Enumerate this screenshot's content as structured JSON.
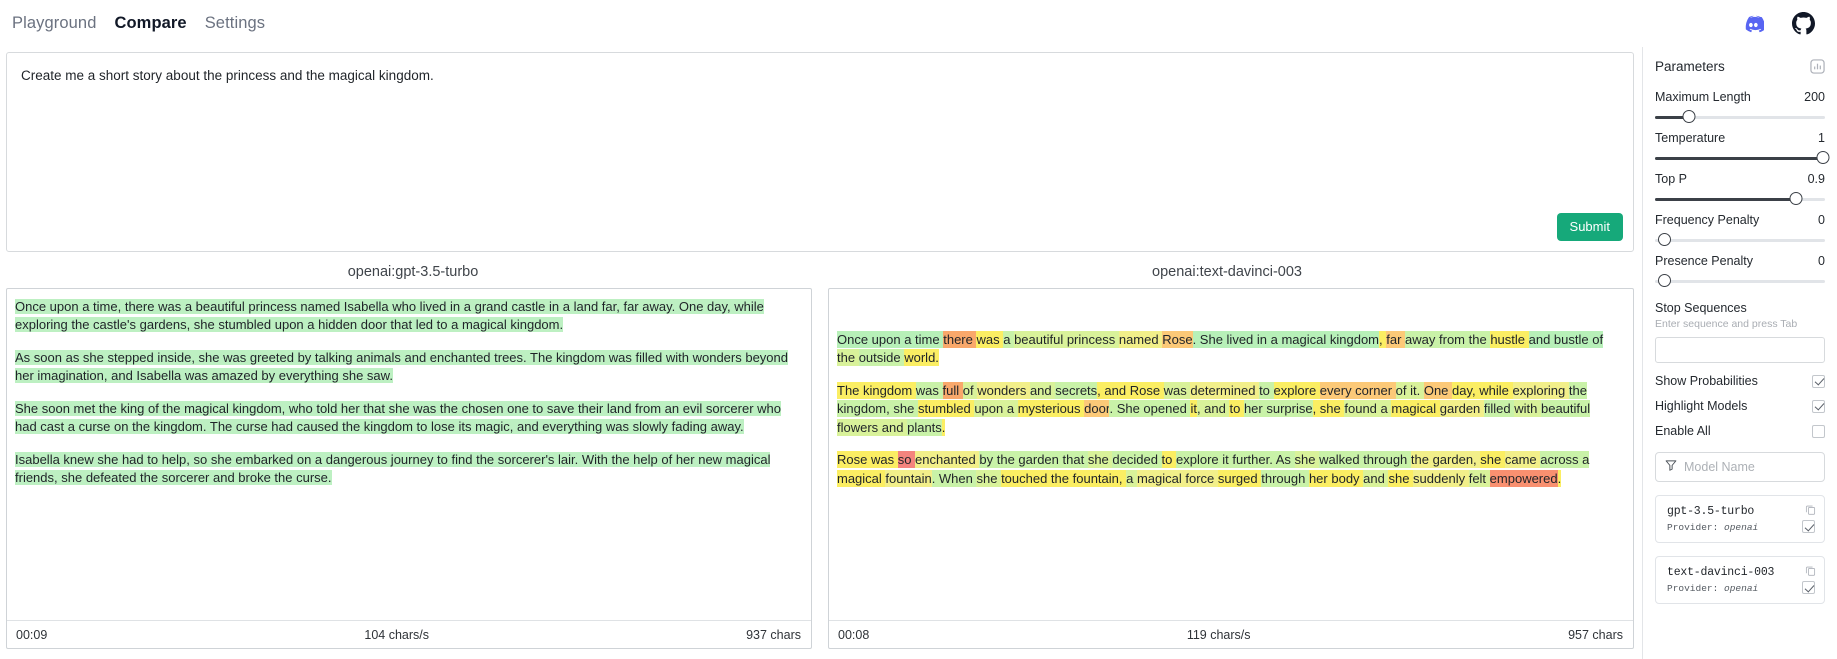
{
  "nav": {
    "items": [
      {
        "label": "Playground",
        "active": false
      },
      {
        "label": "Compare",
        "active": true
      },
      {
        "label": "Settings",
        "active": false
      }
    ],
    "discord_icon": "discord-icon",
    "github_icon": "github-icon"
  },
  "prompt": {
    "text": "Create me a short story about the princess and the magical kingdom.",
    "submit_label": "Submit"
  },
  "outputs": [
    {
      "title": "openai:gpt-3.5-turbo",
      "paragraphs": [
        "Once upon a time, there was a beautiful princess named Isabella who lived in a grand castle in a land far, far away. One day, while exploring the castle's gardens, she stumbled upon a hidden door that led to a magical kingdom.",
        "As soon as she stepped inside, she was greeted by talking animals and enchanted trees. The kingdom was filled with wonders beyond her imagination, and Isabella was amazed by everything she saw.",
        "She soon met the king of the magical kingdom, who told her that she was the chosen one to save their land from an evil sorcerer who had cast a curse on the kingdom. The curse had caused the kingdom to lose its magic, and everything was slowly fading away.",
        "Isabella knew she had to help, so she embarked on a dangerous journey to find the sorcerer's lair. With the help of her new magical friends, she defeated the sorcerer and broke the curse."
      ],
      "footer": {
        "time": "00:09",
        "speed": "104 chars/s",
        "chars": "937 chars"
      }
    },
    {
      "title": "openai:text-davinci-003",
      "token_paragraphs": [
        [
          {
            "t": "Once upon a time ",
            "c": "g0"
          },
          {
            "t": "there ",
            "c": "o1"
          },
          {
            "t": "was ",
            "c": "y1"
          },
          {
            "t": "a ",
            "c": "g1"
          },
          {
            "t": "beautiful princess ",
            "c": "g2"
          },
          {
            "t": "named ",
            "c": "y0"
          },
          {
            "t": "Rose",
            "c": "o0"
          },
          {
            "t": ". She lived in a magical kingdom",
            "c": "g0"
          },
          {
            "t": ", ",
            "c": "y1"
          },
          {
            "t": "far ",
            "c": "o0"
          },
          {
            "t": "away from the ",
            "c": "g1"
          },
          {
            "t": "hustle ",
            "c": "y1"
          },
          {
            "t": "and bustle of ",
            "c": "g0"
          },
          {
            "t": "the ",
            "c": "g2"
          },
          {
            "t": "outside ",
            "c": "g1"
          },
          {
            "t": "world.",
            "c": "y1"
          }
        ],
        [
          {
            "t": "The kingdom ",
            "c": "y1"
          },
          {
            "t": "was ",
            "c": "g1"
          },
          {
            "t": "full ",
            "c": "o1"
          },
          {
            "t": "of ",
            "c": "g2"
          },
          {
            "t": "wonders ",
            "c": "y0"
          },
          {
            "t": "and ",
            "c": "g2"
          },
          {
            "t": "secrets",
            "c": "g1"
          },
          {
            "t": ", and Rose ",
            "c": "y1"
          },
          {
            "t": "was ",
            "c": "g2"
          },
          {
            "t": "determined ",
            "c": "y0"
          },
          {
            "t": "to ",
            "c": "g1"
          },
          {
            "t": "explore ",
            "c": "y1"
          },
          {
            "t": "every corner ",
            "c": "o0"
          },
          {
            "t": "of it. ",
            "c": "g2"
          },
          {
            "t": "One ",
            "c": "o0"
          },
          {
            "t": "day, while ",
            "c": "y1"
          },
          {
            "t": "exploring ",
            "c": "y0"
          },
          {
            "t": "the kingdom, she ",
            "c": "g1"
          },
          {
            "t": "stumbled ",
            "c": "y1"
          },
          {
            "t": "upon a ",
            "c": "g2"
          },
          {
            "t": "mysterious ",
            "c": "y1"
          },
          {
            "t": "door",
            "c": "o0"
          },
          {
            "t": ". She opened ",
            "c": "g1"
          },
          {
            "t": "it",
            "c": "y1"
          },
          {
            "t": ", and ",
            "c": "g2"
          },
          {
            "t": "to ",
            "c": "y1"
          },
          {
            "t": "her surprise",
            "c": "g1"
          },
          {
            "t": ", she ",
            "c": "y1"
          },
          {
            "t": "found a ",
            "c": "g2"
          },
          {
            "t": "magical ",
            "c": "y1"
          },
          {
            "t": "garden ",
            "c": "y0"
          },
          {
            "t": "filled ",
            "c": "g1"
          },
          {
            "t": "with ",
            "c": "g2"
          },
          {
            "t": "beautiful ",
            "c": "g1"
          },
          {
            "t": "flowers and ",
            "c": "g2"
          },
          {
            "t": "plants",
            "c": "g1"
          },
          {
            "t": ".",
            "c": "y1"
          }
        ],
        [
          {
            "t": "Rose was ",
            "c": "y1"
          },
          {
            "t": "so ",
            "c": "r1"
          },
          {
            "t": "enchanted ",
            "c": "y0"
          },
          {
            "t": "by the garden that ",
            "c": "g1"
          },
          {
            "t": "she ",
            "c": "g2"
          },
          {
            "t": "decided ",
            "c": "g1"
          },
          {
            "t": "to ",
            "c": "y1"
          },
          {
            "t": "explore it further. As ",
            "c": "g1"
          },
          {
            "t": "she ",
            "c": "g2"
          },
          {
            "t": "walked through ",
            "c": "g1"
          },
          {
            "t": "the garden, ",
            "c": "y0"
          },
          {
            "t": "she ",
            "c": "y1"
          },
          {
            "t": "came ",
            "c": "y0"
          },
          {
            "t": "across a ",
            "c": "g1"
          },
          {
            "t": "magical ",
            "c": "y1"
          },
          {
            "t": "fountain",
            "c": "y0"
          },
          {
            "t": ". When ",
            "c": "g1"
          },
          {
            "t": "she ",
            "c": "g2"
          },
          {
            "t": "touched the fountain, ",
            "c": "y1"
          },
          {
            "t": "a ",
            "c": "g2"
          },
          {
            "t": "magical force ",
            "c": "y0"
          },
          {
            "t": "surged ",
            "c": "y1"
          },
          {
            "t": "through ",
            "c": "g1"
          },
          {
            "t": "her body ",
            "c": "y1"
          },
          {
            "t": "and ",
            "c": "g2"
          },
          {
            "t": "she ",
            "c": "y1"
          },
          {
            "t": "suddenly ",
            "c": "y0"
          },
          {
            "t": "felt ",
            "c": "g2"
          },
          {
            "t": "empowered",
            "c": "r0"
          },
          {
            "t": ".",
            "c": "y1"
          }
        ]
      ],
      "footer": {
        "time": "00:08",
        "speed": "119 chars/s",
        "chars": "957 chars"
      }
    }
  ],
  "parameters": {
    "title": "Parameters",
    "chart_icon": "bar-chart-icon",
    "sliders": [
      {
        "label": "Maximum Length",
        "value": "200",
        "pct": 20
      },
      {
        "label": "Temperature",
        "value": "1",
        "pct": 100
      },
      {
        "label": "Top P",
        "value": "0.9",
        "pct": 83
      },
      {
        "label": "Frequency Penalty",
        "value": "0",
        "pct": 0
      },
      {
        "label": "Presence Penalty",
        "value": "0",
        "pct": 0
      }
    ],
    "stop_sequences": {
      "label": "Stop Sequences",
      "hint": "Enter sequence and press Tab",
      "value": ""
    },
    "toggles": [
      {
        "label": "Show Probabilities",
        "checked": true
      },
      {
        "label": "Highlight Models",
        "checked": true
      },
      {
        "label": "Enable All",
        "checked": false
      }
    ],
    "filter": {
      "icon": "filter-icon",
      "placeholder": "Model Name"
    },
    "models": [
      {
        "name": "gpt-3.5-turbo",
        "provider_label": "Provider:",
        "provider": "openai",
        "checked": true,
        "copy_icon": "copy-icon"
      },
      {
        "name": "text-davinci-003",
        "provider_label": "Provider:",
        "provider": "openai",
        "checked": true,
        "copy_icon": "copy-icon"
      }
    ]
  }
}
